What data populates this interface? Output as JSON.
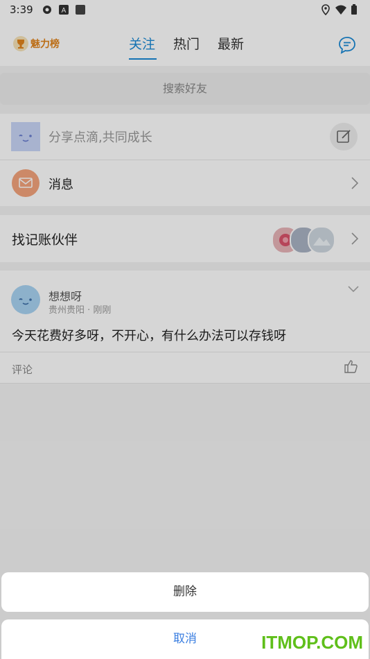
{
  "status_bar": {
    "time": "3:39"
  },
  "header": {
    "charm_label": "魅力榜",
    "tabs": [
      {
        "label": "关注",
        "active": true
      },
      {
        "label": "热门",
        "active": false
      },
      {
        "label": "最新",
        "active": false
      }
    ]
  },
  "search": {
    "placeholder": "搜索好友"
  },
  "share": {
    "text": "分享点滴,共同成长"
  },
  "messages": {
    "label": "消息"
  },
  "partners": {
    "label": "找记账伙伴"
  },
  "post": {
    "author": "想想呀",
    "location": "贵州贵阳",
    "time": "刚刚",
    "content": "今天花费好多呀，不开心，有什么办法可以存钱呀",
    "comment_label": "评论"
  },
  "action_sheet": {
    "delete_label": "删除",
    "cancel_label": "取消"
  },
  "watermark": "ITMOP.COM",
  "colors": {
    "accent": "#1a8ad6",
    "charm": "#e0841c",
    "cancel": "#3a7ee0",
    "watermark": "#5fbf1a"
  }
}
